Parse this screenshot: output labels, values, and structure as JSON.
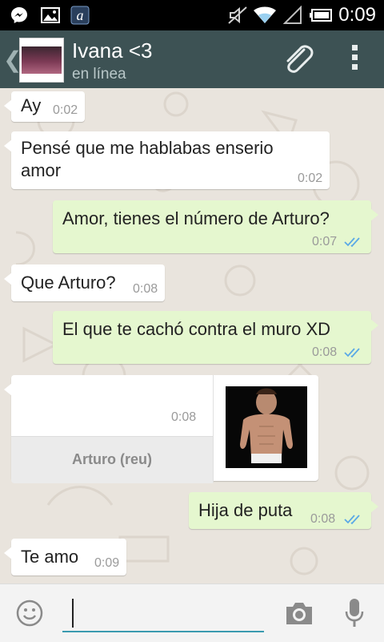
{
  "status_bar": {
    "time": "0:09",
    "icons": [
      "messenger-icon",
      "gallery-icon",
      "app-icon",
      "mute-icon",
      "wifi-icon",
      "signal-icon",
      "battery-icon"
    ]
  },
  "header": {
    "contact_name": "Ivana <3",
    "contact_status": "en línea",
    "icons": [
      "back-chevron-icon",
      "avatar",
      "paperclip-icon",
      "overflow-menu-icon"
    ]
  },
  "messages": [
    {
      "direction": "in",
      "text": "Ay",
      "time": "0:02"
    },
    {
      "direction": "in",
      "text_line1": "Pensé que me hablabas enserio",
      "text_line2": "amor",
      "time": "0:02"
    },
    {
      "direction": "out",
      "text": "Amor, tienes el número de Arturo?",
      "time": "0:07",
      "read": true
    },
    {
      "direction": "in",
      "text": "Que Arturo?",
      "time": "0:08"
    },
    {
      "direction": "out",
      "text": "El que te cachó contra el muro XD",
      "time": "0:08",
      "read": true
    },
    {
      "direction": "in",
      "type": "contact",
      "contact_name": "Arturo (reu)",
      "time": "0:08"
    },
    {
      "direction": "out",
      "text": "Hija de puta",
      "time": "0:08",
      "read": true
    },
    {
      "direction": "in",
      "text": "Te amo",
      "time": "0:09"
    }
  ],
  "input_bar": {
    "placeholder": "",
    "icons": [
      "emoji-icon",
      "camera-icon",
      "microphone-icon"
    ]
  },
  "colors": {
    "header_bg": "#3d5254",
    "chat_bg": "#e9e4dd",
    "incoming_bubble": "#ffffff",
    "outgoing_bubble": "#e5f7cf",
    "read_ticks": "#5aa9e6",
    "input_underline": "#3a9ab0"
  }
}
